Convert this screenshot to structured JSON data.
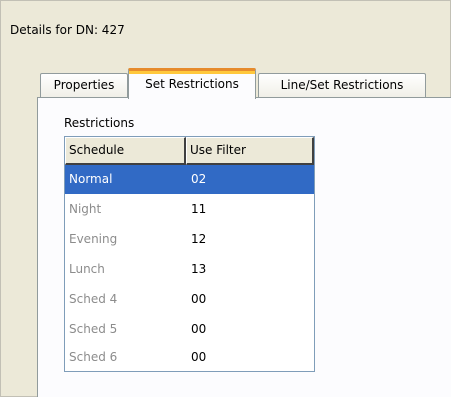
{
  "window": {
    "title": "Details for DN: 427"
  },
  "tabs": [
    {
      "label": "Properties",
      "active": false
    },
    {
      "label": "Set Restrictions",
      "active": true
    },
    {
      "label": "Line/Set Restrictions",
      "active": false
    }
  ],
  "restrictions": {
    "group_label": "Restrictions",
    "columns": [
      "Schedule",
      "Use Filter"
    ],
    "rows": [
      {
        "schedule": "Normal",
        "filter": "02",
        "selected": true
      },
      {
        "schedule": "Night",
        "filter": "11"
      },
      {
        "schedule": "Evening",
        "filter": "12"
      },
      {
        "schedule": "Lunch",
        "filter": "13"
      },
      {
        "schedule": "Sched 4",
        "filter": "00"
      },
      {
        "schedule": "Sched 5",
        "filter": "00"
      },
      {
        "schedule": "Sched 6",
        "filter": "00"
      }
    ]
  },
  "colors": {
    "selection": "#316ac5",
    "tab_accent": "#e68b2c",
    "dialog_bg": "#ece9d8"
  }
}
